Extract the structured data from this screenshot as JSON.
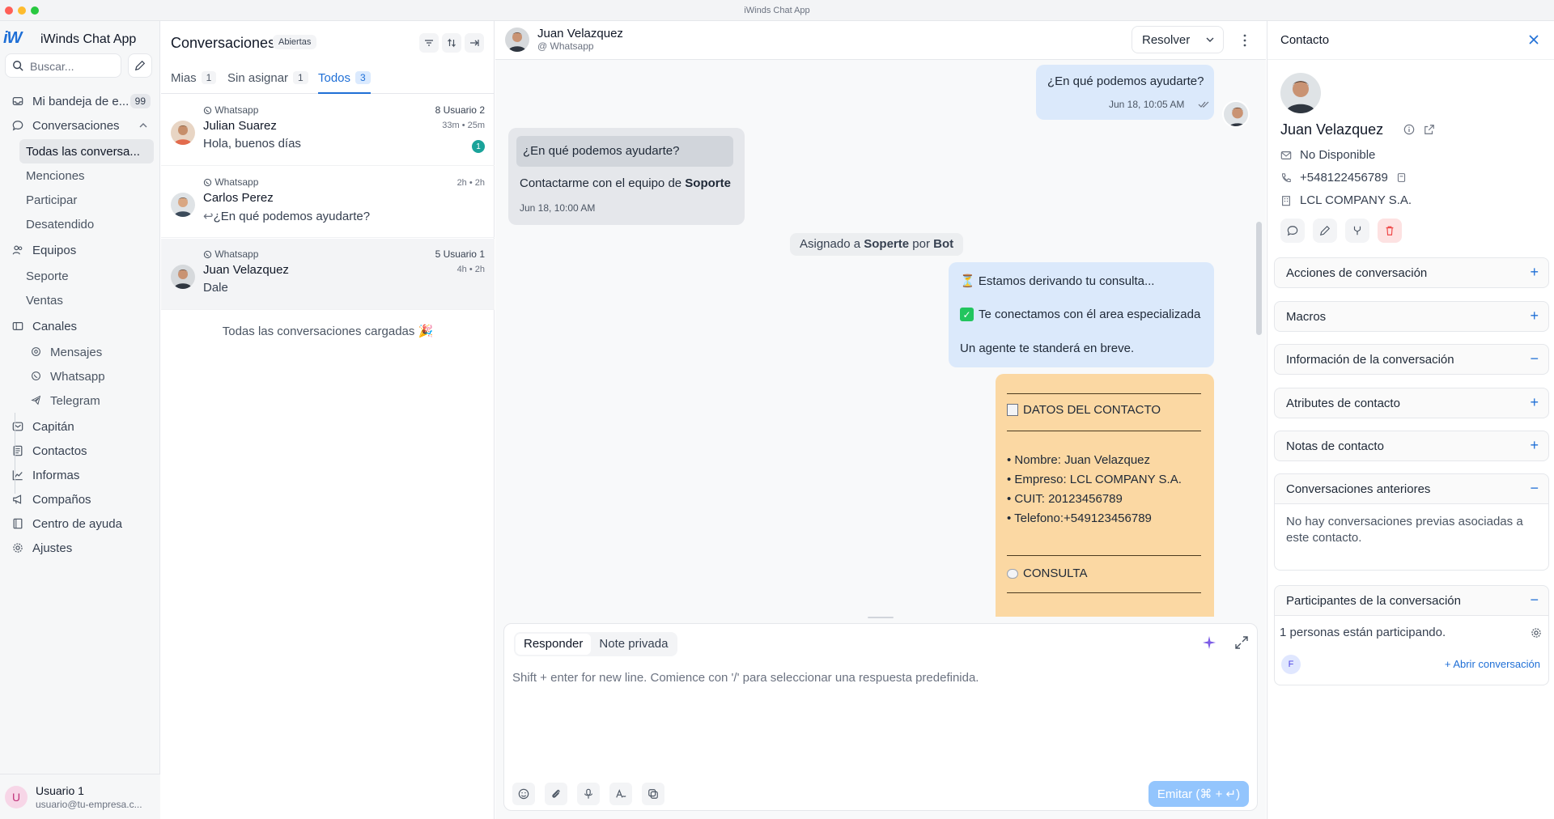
{
  "window": {
    "title": "iWinds Chat App"
  },
  "app": {
    "logo": "iW",
    "name": "iWinds Chat App"
  },
  "search": {
    "placeholder": "Buscar..."
  },
  "sidebar": {
    "inbox": {
      "label": "Mi bandeja de e...",
      "badge": "99"
    },
    "conversations": {
      "label": "Conversaciones"
    },
    "conv_sub": [
      "Todas las conversa...",
      "Menciones",
      "Participar",
      "Desatendido"
    ],
    "teams": {
      "label": "Equipos"
    },
    "team_sub": [
      "Seporte",
      "Ventas"
    ],
    "channels": {
      "label": "Canales"
    },
    "channel_sub": [
      "Mensajes",
      "Whatsapp",
      "Telegram"
    ],
    "bottom": [
      "Capitán",
      "Contactos",
      "Informas",
      "Compaños",
      "Centro de ayuda",
      "Ajustes"
    ]
  },
  "user": {
    "initial": "U",
    "name": "Usuario 1",
    "email": "usuario@tu-empresa.c..."
  },
  "convlist": {
    "title": "Conversaciones",
    "status_pill": "Abiertas",
    "tabs": [
      {
        "label": "Mias",
        "count": "1"
      },
      {
        "label": "Sin asignar",
        "count": "1"
      },
      {
        "label": "Todos",
        "count": "3"
      }
    ],
    "items": [
      {
        "channel": "Whatsapp",
        "name": "Julian Suarez",
        "message": "Hola, buenos días",
        "right": "8 Usuario 2",
        "time": "33m • 25m",
        "unread": "1"
      },
      {
        "channel": "Whatsapp",
        "name": "Carlos Perez",
        "message": "¿En qué podemos ayudarte?",
        "right": "",
        "time": "2h • 2h",
        "unread": ""
      },
      {
        "channel": "Whatsapp",
        "name": "Juan Velazquez",
        "message": "Dale",
        "right": "5 Usuario 1",
        "time": "4h • 2h",
        "unread": ""
      }
    ],
    "all_loaded": "Todas las conversaciones cargadas 🎉"
  },
  "chat": {
    "contact_name": "Juan Velazquez",
    "channel": "@ Whatsapp",
    "resolve_label": "Resolver",
    "msg1": {
      "text": "¿En qué podemos ayudarte?",
      "time": "Jun 18, 10:05 AM"
    },
    "msg2": {
      "quote": "¿En qué podemos ayudarte?",
      "text_pre": "Contactarme con el equipo de ",
      "text_bold": "Soporte",
      "time": "Jun 18, 10:00 AM"
    },
    "system": {
      "pre": "Asignado a ",
      "team": "Soperte",
      "mid": " por ",
      "bot": "Bot"
    },
    "msg3": {
      "line1": "⏳ Estamos derivando tu consulta...",
      "line2": "Te conectamos con él area especializada",
      "line3": "Un agente te standerá en breve."
    },
    "note": {
      "title": "DATOS DEL CONTACTO",
      "items": [
        "• Nombre: Juan Velazquez",
        "• Empreso: LCL COMPANY S.A.",
        "• CUIT: 20123456789",
        "• Telefono:+549123456789"
      ],
      "consulta": "CONSULTA"
    }
  },
  "composer": {
    "mode_reply": "Responder",
    "mode_note": "Note privada",
    "placeholder": "Shift + enter for new line. Comience con '/' para seleccionar una respuesta predefinida.",
    "send_label": "Emitar (⌘ + ↵)"
  },
  "contact": {
    "header": "Contacto",
    "name": "Juan Velazquez",
    "email": "No Disponible",
    "phone": "+548122456789",
    "company": "LCL COMPANY S.A.",
    "sections": [
      {
        "title": "Acciones de conversación",
        "sign": "+"
      },
      {
        "title": "Macros",
        "sign": "+"
      },
      {
        "title": "Información de la conversación",
        "sign": "−"
      },
      {
        "title": "Atributes de contacto",
        "sign": "+"
      },
      {
        "title": "Notas de contacto",
        "sign": "+"
      },
      {
        "title": "Conversaciones anteriores",
        "sign": "−"
      },
      {
        "title": "Participantes de la conversación",
        "sign": "−"
      }
    ],
    "previous_empty": "No hay conversaciones previas asociadas a este contacto.",
    "participants_text": "1 personas están participando.",
    "participant_initial": "F",
    "open_conversation": "+ Abrir conversación"
  },
  "colors": {
    "accent": "#1f6fd6",
    "outgoing": "#dbe9fb",
    "note": "#fbd8a3",
    "unread": "#1aa39a"
  }
}
